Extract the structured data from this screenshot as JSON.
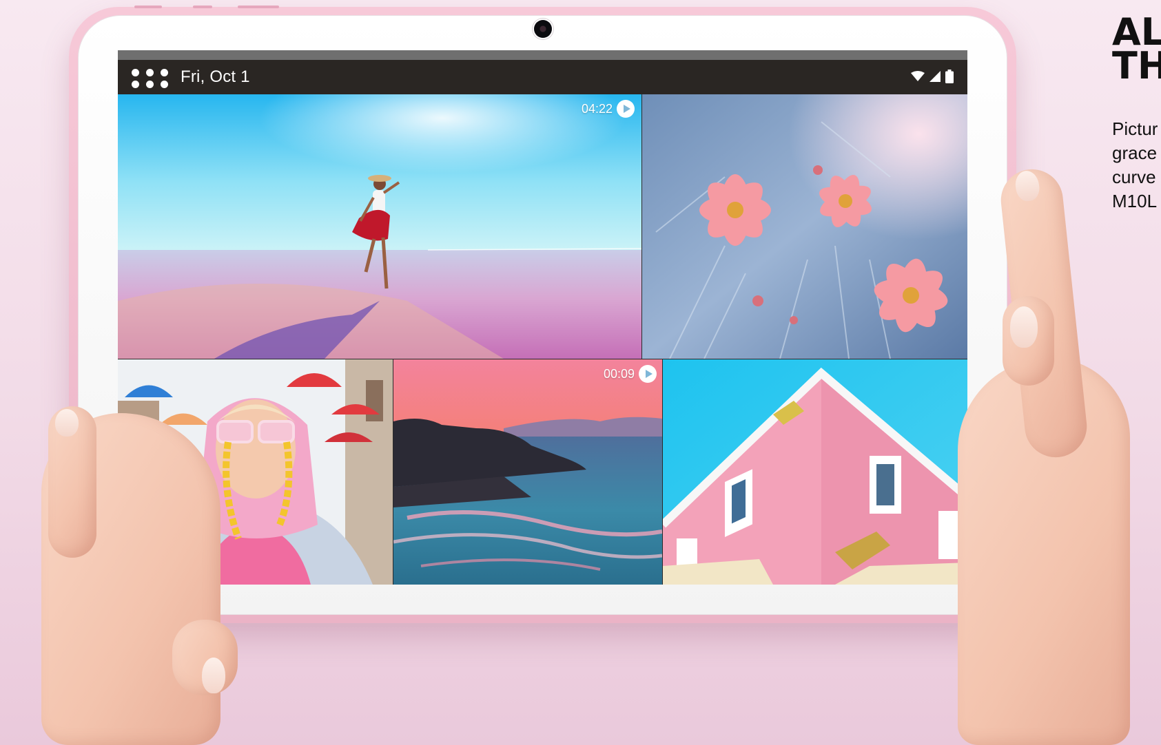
{
  "status_bar": {
    "date": "Fri, Oct 1",
    "icons": [
      "apps-grid-icon",
      "wifi-icon",
      "signal-icon",
      "battery-icon"
    ]
  },
  "gallery": {
    "tiles": [
      {
        "subject": "woman-dancing-on-beach",
        "video_duration": "04:22"
      },
      {
        "subject": "pink-cosmos-flowers"
      },
      {
        "subject": "woman-pink-sunglasses-hoodie"
      },
      {
        "subject": "sunset-seascape",
        "video_duration": "00:09"
      },
      {
        "subject": "pink-building-facade"
      }
    ]
  },
  "side_copy": {
    "headline_line1": "AL",
    "headline_line2": "TH",
    "body_lines": [
      "Pictur",
      "grace",
      "curve",
      "M10L"
    ]
  },
  "colors": {
    "background": "#f2dbe7",
    "tablet_shell": "#f3bccf",
    "bezel": "#ffffff",
    "status_bar": "#2a2623"
  }
}
